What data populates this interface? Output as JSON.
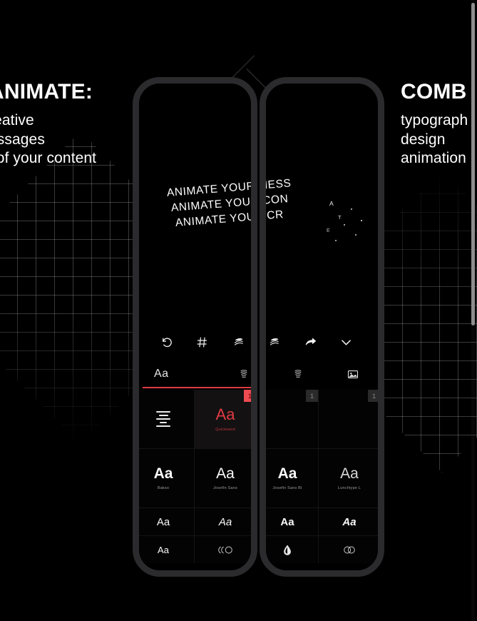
{
  "page": {
    "background_color": "#000000",
    "accent_color": "#e03b43"
  },
  "copy_left": {
    "headline": "ANIMATE:",
    "lines": [
      "reative",
      "essages",
      "l of your content"
    ]
  },
  "copy_right": {
    "headline": "COMB",
    "lines": [
      "typograph",
      "design",
      "animation"
    ]
  },
  "phone_app": {
    "canvas": {
      "word_lines": [
        "ANIMATE YOUR MESS",
        "ANIMATE YOUR CON",
        "ANIMATE YOUR CR"
      ],
      "particles": [
        "A",
        "T",
        "E"
      ]
    },
    "toolbar": {
      "icons": [
        {
          "name": "undo-icon",
          "label": "Undo"
        },
        {
          "name": "grid-icon",
          "label": "Grid"
        },
        {
          "name": "layers-icon",
          "label": "Layers"
        },
        {
          "name": "layers-alt-icon",
          "label": "Layers"
        },
        {
          "name": "share-arrow-icon",
          "label": "Share"
        },
        {
          "name": "chevron-down-icon",
          "label": "Collapse"
        }
      ]
    },
    "tabs": [
      {
        "name": "tab-text",
        "label": "Aa",
        "active": true
      },
      {
        "name": "tab-wave",
        "label": "",
        "active": false
      },
      {
        "name": "tab-wave-alt",
        "label": "",
        "active": false
      },
      {
        "name": "tab-image",
        "label": "",
        "active": false
      }
    ],
    "font_grid": {
      "row1": [
        {
          "sample": "",
          "name": "",
          "icon": "text-align-icon",
          "selected": false,
          "badge": null
        },
        {
          "sample": "Aa",
          "name": "Quicksand",
          "icon": null,
          "selected": true,
          "badge": "1"
        },
        {
          "sample": "",
          "name": "",
          "icon": null,
          "selected": false,
          "badge": "1"
        },
        {
          "sample": "",
          "name": "",
          "icon": null,
          "selected": false,
          "badge": "1"
        }
      ],
      "row2": [
        {
          "sample": "Aa",
          "name": "Bakso",
          "weight": "bold"
        },
        {
          "sample": "Aa",
          "name": "Josefin Sans",
          "weight": "normal"
        },
        {
          "sample": "Aa",
          "name": "Josefin Sans Bl",
          "weight": "bold"
        },
        {
          "sample": "Aa",
          "name": "Lunchtype L",
          "weight": "normal"
        }
      ],
      "row3": [
        {
          "sample": "Aa",
          "style": "normal"
        },
        {
          "sample": "Aa",
          "style": "italic"
        },
        {
          "sample": "Aa",
          "style": "bold"
        },
        {
          "sample": "Aa",
          "style": "bold-italic"
        }
      ],
      "row4": [
        {
          "sample": "Aa",
          "icon": null
        },
        {
          "sample": "",
          "icon": "arc-circle-icon"
        },
        {
          "sample": "",
          "icon": "droplet-icon"
        },
        {
          "sample": "",
          "icon": "double-circle-icon"
        }
      ]
    }
  },
  "scrollbar": {
    "name": "page-scrollbar",
    "position": "right"
  }
}
